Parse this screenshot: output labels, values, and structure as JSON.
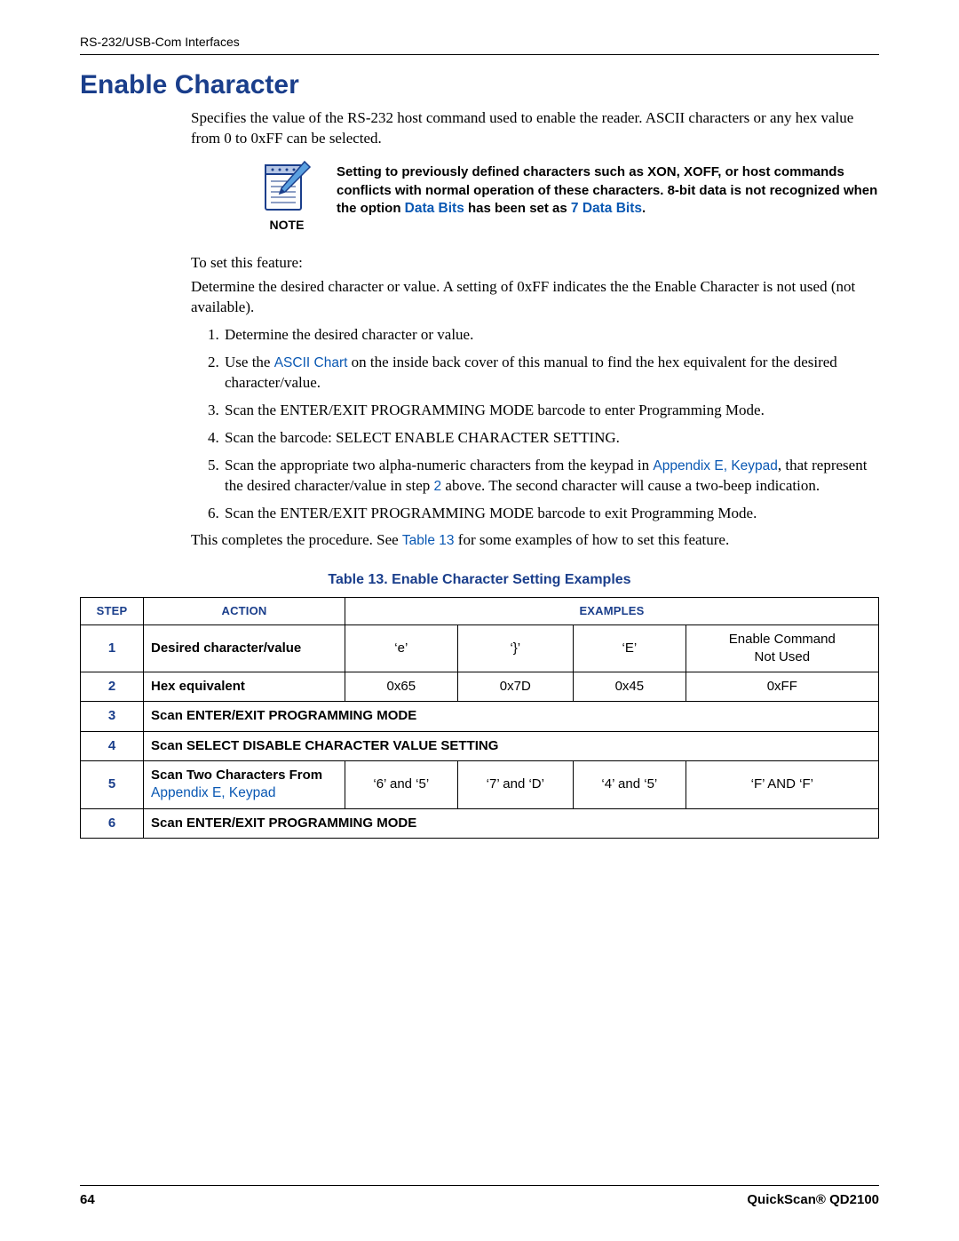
{
  "header": {
    "running": "RS-232/USB-Com Interfaces"
  },
  "title": "Enable Character",
  "intro": "Specifies the value of the RS-232 host command used to enable the reader. ASCII characters or any hex value from 0 to 0xFF can be selected.",
  "note": {
    "label": "NOTE",
    "text_pre": "Setting to previously defined characters such as XON, XOFF, or host commands conflicts with normal operation of these characters. 8-bit data is not recognized when the option ",
    "link1": "Data Bits",
    "text_mid": " has been set as ",
    "link2": "7 Data Bits",
    "text_post": "."
  },
  "lead1": "To set this feature:",
  "lead2": "Determine the desired character or value. A setting of 0xFF indicates the the Enable Character is not used (not available).",
  "steps": {
    "s1": "Determine the desired character or value.",
    "s2_pre": "Use the ",
    "s2_link": "ASCII Chart",
    "s2_post": " on the inside back cover of this manual to find the hex equivalent for the desired character/value.",
    "s3": "Scan the ENTER/EXIT PROGRAMMING MODE barcode to enter Programming Mode.",
    "s4": "Scan the barcode: SELECT ENABLE CHARACTER SETTING.",
    "s5_pre": "Scan the appropriate two alpha-numeric characters from the keypad in ",
    "s5_link": "Appendix E, Keypad",
    "s5_mid": ", that represent the desired character/value in step ",
    "s5_link2": "2",
    "s5_post": " above. The second character will cause a two-beep indication.",
    "s6": "Scan the ENTER/EXIT PROGRAMMING MODE barcode to exit Programming Mode."
  },
  "closing_pre": "This completes the procedure. See ",
  "closing_link": "Table 13",
  "closing_post": " for some examples of how to set this feature.",
  "table": {
    "caption": "Table 13. Enable Character Setting Examples",
    "headers": {
      "step": "STEP",
      "action": "ACTION",
      "examples": "EXAMPLES"
    },
    "rows": {
      "r1": {
        "step": "1",
        "action": "Desired character/value",
        "c1": "‘e’",
        "c2": "‘}’",
        "c3": "‘E’",
        "c4a": "Enable Command",
        "c4b": "Not Used"
      },
      "r2": {
        "step": "2",
        "action": "Hex equivalent",
        "c1": "0x65",
        "c2": "0x7D",
        "c3": "0x45",
        "c4": "0xFF"
      },
      "r3": {
        "step": "3",
        "action": "Scan ENTER/EXIT PROGRAMMING MODE"
      },
      "r4": {
        "step": "4",
        "action": "Scan SELECT DISABLE CHARACTER VALUE SETTING"
      },
      "r5": {
        "step": "5",
        "action_line1": "Scan Two Characters From",
        "action_link": "Appendix E, Keypad",
        "c1": "‘6’ and ‘5’",
        "c2": "‘7’ and ‘D’",
        "c3": "‘4’ and ‘5’",
        "c4": "‘F’ AND ‘F’"
      },
      "r6": {
        "step": "6",
        "action": "Scan ENTER/EXIT PROGRAMMING MODE"
      }
    }
  },
  "footer": {
    "page": "64",
    "product": "QuickScan® QD2100"
  }
}
